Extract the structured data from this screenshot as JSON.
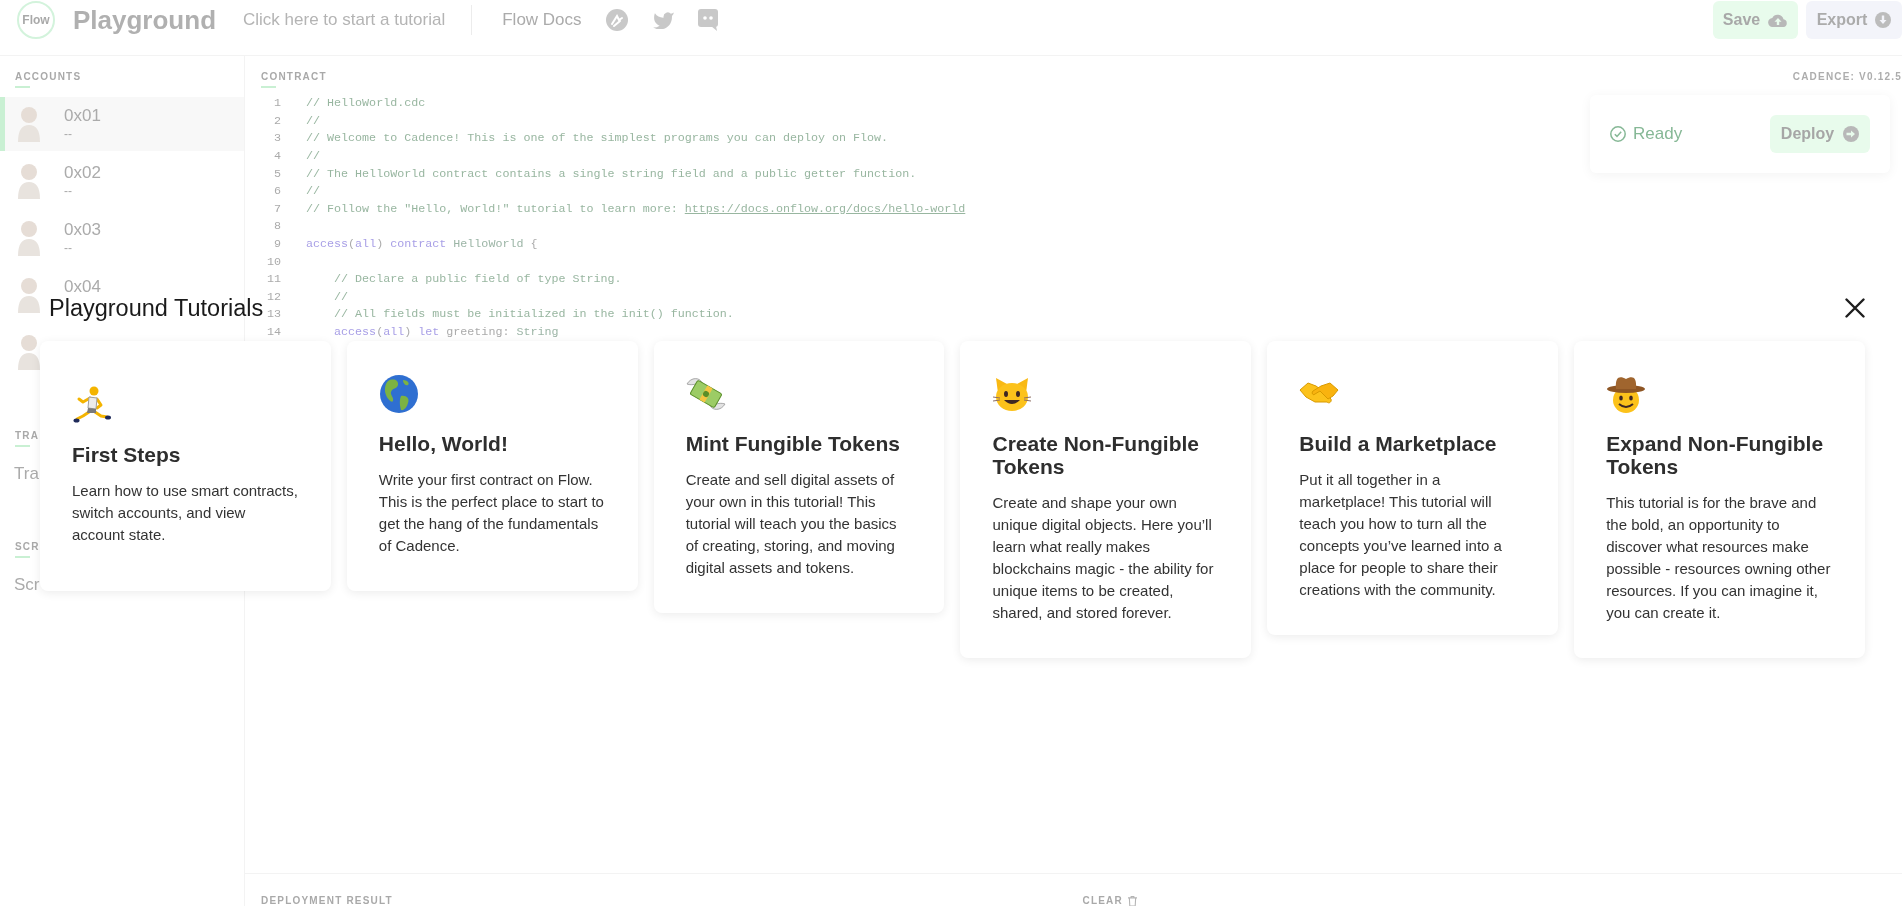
{
  "header": {
    "logo": "Flow",
    "title": "Playground",
    "tutorial_prompt": "Click here to start a tutorial",
    "docs_link": "Flow Docs",
    "buttons": [
      {
        "label": "Save",
        "kind": "save"
      },
      {
        "label": "Export",
        "kind": "export"
      }
    ]
  },
  "sidebar": {
    "accounts_heading": "ACCOUNTS",
    "accounts": [
      {
        "address": "0x01",
        "balance": "--",
        "selected": true
      },
      {
        "address": "0x02",
        "balance": "--",
        "selected": false
      },
      {
        "address": "0x03",
        "balance": "--",
        "selected": false
      },
      {
        "address": "0x04",
        "selected": false
      },
      {
        "selected": false
      }
    ],
    "transactions_heading": "TRA",
    "transactions": [
      "Tra"
    ],
    "scripts_heading": "SCR",
    "scripts": [
      "Scr"
    ]
  },
  "editor": {
    "heading": "CONTRACT",
    "version": "CADENCE: V0.12.5",
    "lines": [
      {
        "number": "1",
        "segments": [
          {
            "kind": "comment",
            "text": "// HelloWorld.cdc"
          }
        ]
      },
      {
        "number": "2",
        "segments": [
          {
            "kind": "comment",
            "text": "//"
          }
        ]
      },
      {
        "number": "3",
        "segments": [
          {
            "kind": "comment",
            "text": "// Welcome to Cadence! This is one of the simplest programs you can deploy on Flow."
          }
        ]
      },
      {
        "number": "4",
        "segments": [
          {
            "kind": "comment",
            "text": "//"
          }
        ]
      },
      {
        "number": "5",
        "segments": [
          {
            "kind": "comment",
            "text": "// The HelloWorld contract contains a single string field and a public getter function."
          }
        ]
      },
      {
        "number": "6",
        "segments": [
          {
            "kind": "comment",
            "text": "//"
          }
        ]
      },
      {
        "number": "7",
        "segments": [
          {
            "kind": "comment",
            "text": "// Follow the \"Hello, World!\" tutorial to learn more: "
          },
          {
            "kind": "link",
            "text": "https://docs.onflow.org/docs/hello-world"
          }
        ]
      },
      {
        "number": "8"
      },
      {
        "number": "9",
        "segments": [
          {
            "kind": "keyword",
            "text": "access"
          },
          {
            "kind": "plain",
            "text": "("
          },
          {
            "kind": "keyword",
            "text": "all"
          },
          {
            "kind": "plain",
            "text": ")"
          },
          {
            "kind": "keyword",
            "text": " contract"
          },
          {
            "kind": "type",
            "text": " HelloWorld"
          },
          {
            "kind": "plain",
            "text": " {"
          }
        ]
      },
      {
        "number": "10"
      },
      {
        "number": "11",
        "segments": [
          {
            "kind": "comment",
            "text": "    // Declare a public field of type String."
          }
        ]
      },
      {
        "number": "12",
        "segments": [
          {
            "kind": "comment",
            "text": "    //"
          }
        ]
      },
      {
        "number": "13",
        "segments": [
          {
            "kind": "comment",
            "text": "    // All fields must be initialized in the init() function."
          }
        ]
      },
      {
        "number": "14",
        "segments": [
          {
            "kind": "keyword",
            "text": "    access"
          },
          {
            "kind": "plain",
            "text": "("
          },
          {
            "kind": "keyword",
            "text": "all"
          },
          {
            "kind": "plain",
            "text": ")"
          },
          {
            "kind": "keyword",
            "text": " let"
          },
          {
            "kind": "plain",
            "text": " greeting: "
          },
          {
            "kind": "type",
            "text": "String"
          }
        ]
      }
    ]
  },
  "status": {
    "label": "Ready",
    "button": "Deploy"
  },
  "results": {
    "heading": "DEPLOYMENT RESULT",
    "clear": "CLEAR"
  },
  "tutorials": {
    "title": "Playground Tutorials",
    "cards": [
      {
        "title": "First Steps",
        "description": "Learn how to use smart contracts, switch accounts, and view account state."
      },
      {
        "title": "Hello, World!",
        "description": "Write your first contract on Flow. This is the perfect place to start to get the hang of the fundamentals of Cadence."
      },
      {
        "title": "Mint Fungible Tokens",
        "description": "Create and sell digital assets of your own in this tutorial! This tutorial will teach you the basics of creating, storing, and moving digital assets and tokens."
      },
      {
        "title": "Create Non-Fungible Tokens",
        "description": "Create and shape your own unique digital objects. Here you’ll learn what really makes blockchains magic - the ability for unique items to be created, shared, and stored forever."
      },
      {
        "title": "Build a Marketplace",
        "description": "Put it all together in a marketplace! This tutorial will teach you how to turn all the concepts you’ve learned into a place for people to share their creations with the community."
      },
      {
        "title": "Expand Non-Fungible Tokens",
        "description": "This tutorial is for the brave and the bold, an opportunity to discover what resources make possible - resources owning other resources. If you can imagine it, you can create it."
      }
    ]
  }
}
